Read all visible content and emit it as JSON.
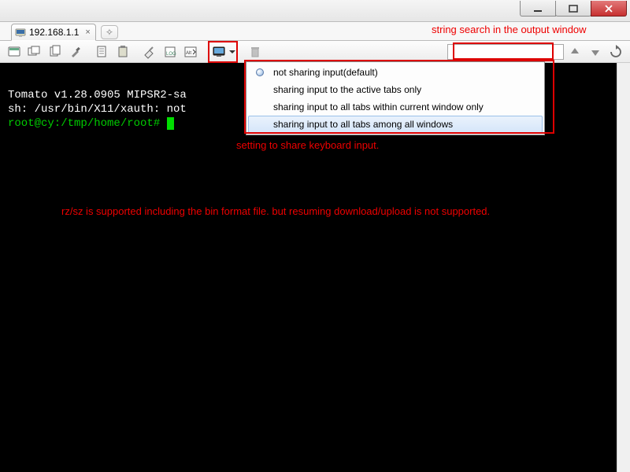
{
  "window": {
    "min_tip": "Minimize",
    "max_tip": "Maximize",
    "close_tip": "Close"
  },
  "tab": {
    "title": "192.168.1.1"
  },
  "toolbar": {
    "search_placeholder": ""
  },
  "dropdown": {
    "items": [
      "not sharing input(default)",
      "sharing input to the active tabs only",
      "sharing input to all tabs within current window only",
      "sharing input to all tabs among all windows"
    ],
    "selected_index": 0,
    "highlight_index": 3
  },
  "terminal": {
    "lines": [
      "Tomato v1.28.0905 MIPSR2-sa",
      "sh: /usr/bin/X11/xauth: not"
    ],
    "prompt": "root@cy:/tmp/home/root# "
  },
  "annotations": {
    "search": "string search in the output window",
    "share_setting": "setting to share keyboard input.",
    "rzsz": "rz/sz is supported including the bin format file. but resuming download/upload is not supported."
  }
}
